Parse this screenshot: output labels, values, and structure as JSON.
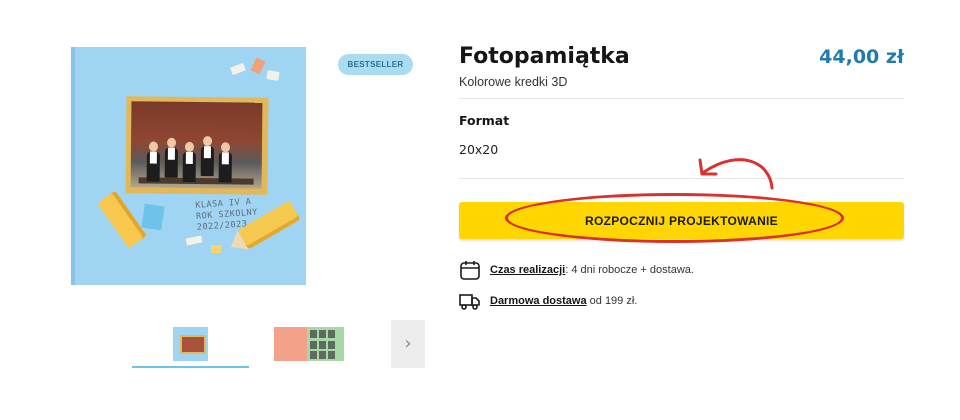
{
  "product": {
    "badge": "BESTSELLER",
    "cover_text_line1": "KLASA IV A",
    "cover_text_line2": "ROK SZKOLNY 2022/2023",
    "title": "Fotopamiątka",
    "subtitle": "Kolorowe kredki 3D",
    "price": "44,00 zł"
  },
  "options": {
    "format_label": "Format",
    "format_value": "20x20"
  },
  "cta": {
    "label": "ROZPOCZNIJ PROJEKTOWANIE"
  },
  "info": {
    "lead_time_link": "Czas realizacji",
    "lead_time_text": ": 4 dni robocze + dostawa.",
    "delivery_link": "Darmowa dostawa",
    "delivery_text": " od 199 zł."
  },
  "gallery": {
    "next_glyph": "›"
  },
  "colors": {
    "accent_yellow": "#ffd600",
    "price_blue": "#1f7cad",
    "annotation_red": "#d8312f",
    "badge_bg": "#a9dbf1"
  },
  "icons": [
    "calendar-icon",
    "delivery-truck-icon",
    "chevron-right-icon"
  ]
}
